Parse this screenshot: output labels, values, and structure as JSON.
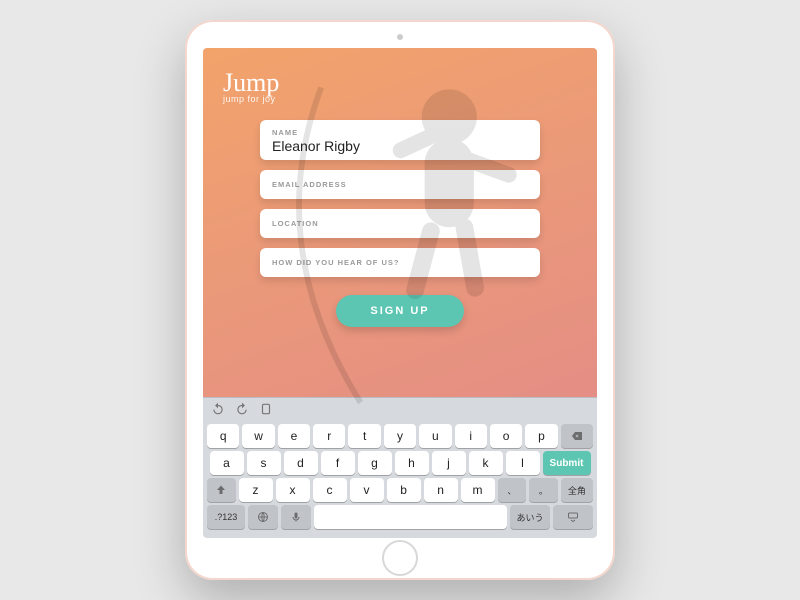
{
  "brand": {
    "name": "Jump",
    "tagline": "jump for joy"
  },
  "form": {
    "fields": [
      {
        "label": "NAME",
        "value": "Eleanor Rigby"
      },
      {
        "label": "EMAIL ADDRESS",
        "value": ""
      },
      {
        "label": "LOCATION",
        "value": ""
      },
      {
        "label": "HOW DID YOU HEAR OF US?",
        "value": ""
      }
    ],
    "submit": "SIGN UP"
  },
  "keyboard": {
    "row1": [
      "q",
      "w",
      "e",
      "r",
      "t",
      "y",
      "u",
      "i",
      "o",
      "p"
    ],
    "row2": [
      "a",
      "s",
      "d",
      "f",
      "g",
      "h",
      "j",
      "k",
      "l"
    ],
    "row3": [
      "z",
      "x",
      "c",
      "v",
      "b",
      "n",
      "m"
    ],
    "submit": "Submit",
    "numkey": ".?123",
    "zenkaku": "全角",
    "kana": "あいう"
  }
}
